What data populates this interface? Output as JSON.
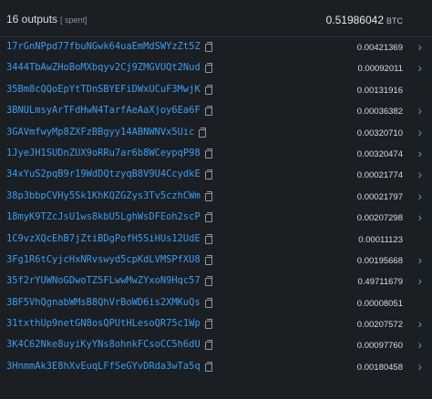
{
  "header": {
    "count_label": "16 outputs",
    "spent_label": "[ spent]",
    "total_value": "0.51986042",
    "total_unit": "BTC"
  },
  "icons": {
    "copy": "copy-icon",
    "chevron": "chevron-right-icon"
  },
  "colors": {
    "address": "#3b9cf0",
    "background": "#1b1f24",
    "chevron": "#3b9cf0"
  },
  "outputs": [
    {
      "address": "17rGnNPpd77fbuNGwk64uaEmMdSWYzZt5Z",
      "amount": "0.00421369",
      "has_chevron": true
    },
    {
      "address": "3444TbAwZHoBoMXbqyv2Cj9ZMGVUQt2Nud",
      "amount": "0.00092011",
      "has_chevron": true
    },
    {
      "address": "35Bm8cQQoEpYtTDnSBYEFiDWxUCuF3MwjK",
      "amount": "0.00131916",
      "has_chevron": false
    },
    {
      "address": "3BNULmsyArTFdHwN4TarfAeAaXjoy6Ea6F",
      "amount": "0.00036382",
      "has_chevron": true
    },
    {
      "address": "3GAVmfwyMp8ZXFzBBgyy14ABNWNVx5Uic",
      "amount": "0.00320710",
      "has_chevron": true
    },
    {
      "address": "1JyeJH1SUDnZUX9oRRu7ar6b8WCeypqP98",
      "amount": "0.00320474",
      "has_chevron": true
    },
    {
      "address": "34xYuS2pqB9r19WdDQtzyqB8V9U4CcydkE",
      "amount": "0.00021774",
      "has_chevron": true
    },
    {
      "address": "38p3bbpCVHy5Sk1KhKQZGZys3Tv5czhCWm",
      "amount": "0.00021797",
      "has_chevron": true
    },
    {
      "address": "18myK9TZcJsU1ws8kbU5LghWsDFEoh2scP",
      "amount": "0.00207298",
      "has_chevron": true
    },
    {
      "address": "1C9vzXQcEhB7jZtiBDgPofH5SiHUs12UdE",
      "amount": "0.00011123",
      "has_chevron": false
    },
    {
      "address": "3Fg1R6tCyjcHxNRvswyd5cpKdLVMSPfXU8",
      "amount": "0.00195668",
      "has_chevron": true
    },
    {
      "address": "35f2rYUWNoGDwoTZ5FLwwMwZYxoN9Hqc57",
      "amount": "0.49711679",
      "has_chevron": true
    },
    {
      "address": "3BF5VhQgnabWMsB8QhVrBoWD6is2XMKuQs",
      "amount": "0.00008051",
      "has_chevron": false
    },
    {
      "address": "31txthUp9netGN8osQPUtHLesoQR75c1Wp",
      "amount": "0.00207572",
      "has_chevron": true
    },
    {
      "address": "3K4C62Nke8uyiKyYNs8ohnkFCsoCC5h6dU",
      "amount": "0.00097760",
      "has_chevron": true
    },
    {
      "address": "3HnmmAk3E8hXvEuqLFfSeGYvDRda3wTa5q",
      "amount": "0.00180458",
      "has_chevron": true
    }
  ]
}
